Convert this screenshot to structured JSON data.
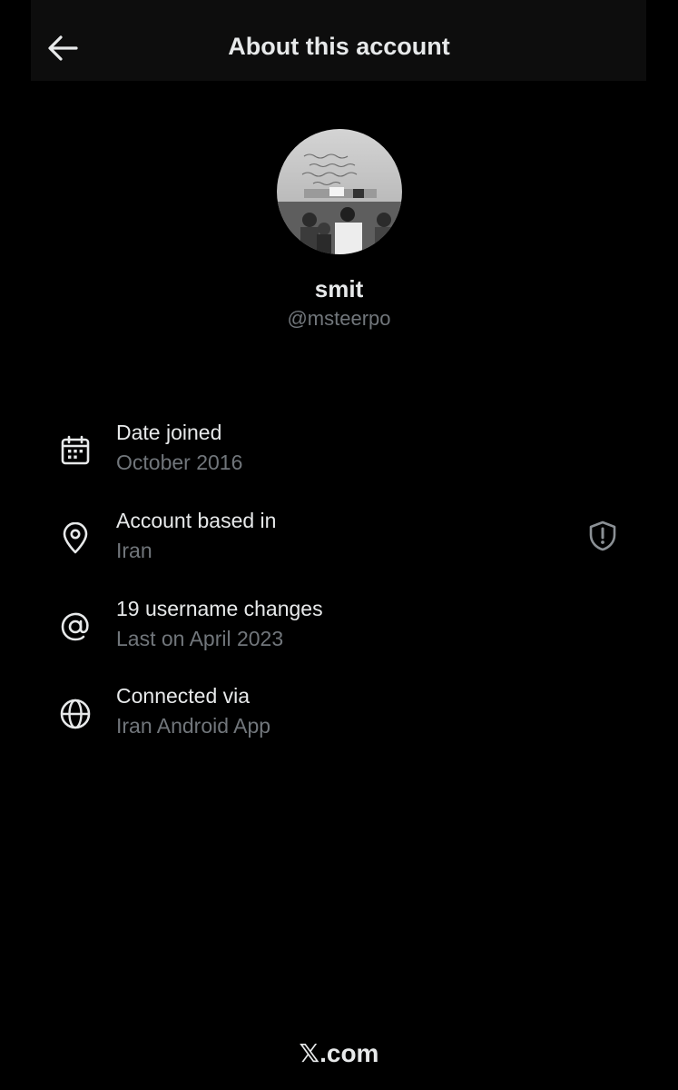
{
  "header": {
    "title": "About this account",
    "back_icon": "arrow-left-icon"
  },
  "profile": {
    "display_name": "smit",
    "handle": "@msteerpo",
    "avatar": "profile-photo"
  },
  "details": [
    {
      "icon": "calendar-icon",
      "label": "Date joined",
      "value": "October 2016"
    },
    {
      "icon": "location-pin-icon",
      "label": "Account based in",
      "value": "Iran"
    },
    {
      "icon": "at-sign-icon",
      "label": "19 username changes",
      "value": "Last on April 2023"
    },
    {
      "icon": "globe-icon",
      "label": "Connected via",
      "value": "Iran Android App"
    }
  ],
  "shield_icon": "shield-alert-icon",
  "footer": {
    "brand": "𝕏",
    "domain": ".com"
  },
  "colors": {
    "background": "#000000",
    "primary_text": "#e7e9ea",
    "secondary_text": "#71767b"
  }
}
